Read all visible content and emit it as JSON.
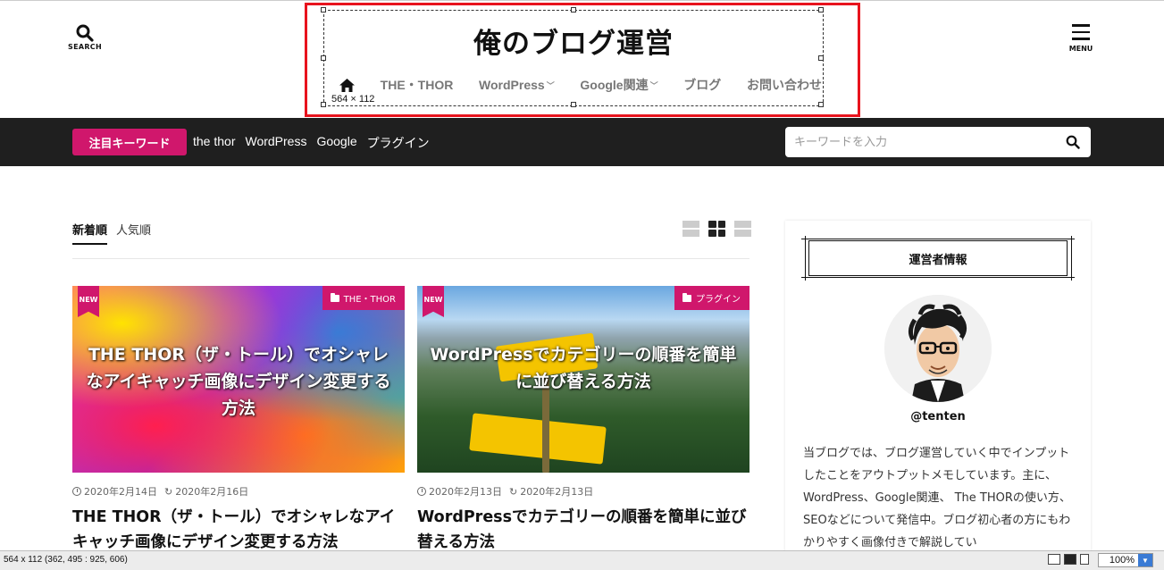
{
  "header": {
    "search_label": "SEARCH",
    "menu_label": "MENU",
    "site_title": "俺のブログ運営",
    "selection_dims": "564 × 112",
    "nav": [
      {
        "label": "THE・THOR",
        "has_dropdown": false
      },
      {
        "label": "WordPress",
        "has_dropdown": true
      },
      {
        "label": "Google関連",
        "has_dropdown": true
      },
      {
        "label": "ブログ",
        "has_dropdown": false
      },
      {
        "label": "お問い合わせ",
        "has_dropdown": false
      }
    ]
  },
  "keyword_bar": {
    "badge": "注目キーワード",
    "keywords": [
      "the thor",
      "WordPress",
      "Google",
      "プラグイン"
    ],
    "search_placeholder": "キーワードを入力"
  },
  "main": {
    "tabs": [
      {
        "label": "新着順",
        "active": true
      },
      {
        "label": "人気順",
        "active": false
      }
    ],
    "cards": [
      {
        "new_label": "NEW",
        "category": "THE・THOR",
        "image_caption": "THE THOR（ザ・トール）でオシャレなアイキャッチ画像にデザイン変更する方法",
        "published": "2020年2月14日",
        "updated": "2020年2月16日",
        "title": "THE THOR（ザ・トール）でオシャレなアイキャッチ画像にデザイン変更する方法"
      },
      {
        "new_label": "NEW",
        "category": "プラグイン",
        "image_caption": "WordPressでカテゴリーの順番を簡単に並び替える方法",
        "published": "2020年2月13日",
        "updated": "2020年2月13日",
        "title": "WordPressでカテゴリーの順番を簡単に並び替える方法"
      }
    ]
  },
  "sidebar": {
    "widget_title": "運営者情報",
    "handle": "@tenten",
    "profile": "当ブログでは、ブログ運営していく中でインプットしたことをアウトプットメモしています。主に、WordPress、Google関連、 The THORの使い方、SEOなどについて発信中。ブログ初心者の方にもわかりやすく画像付きで解説してい"
  },
  "statusbar": {
    "info": "564 x 112  (362, 495 : 925, 606)",
    "zoom": "100%"
  },
  "colors": {
    "accent": "#d0176c",
    "keyword_bar": "#1f1f1f",
    "selection": "#e8131d"
  }
}
